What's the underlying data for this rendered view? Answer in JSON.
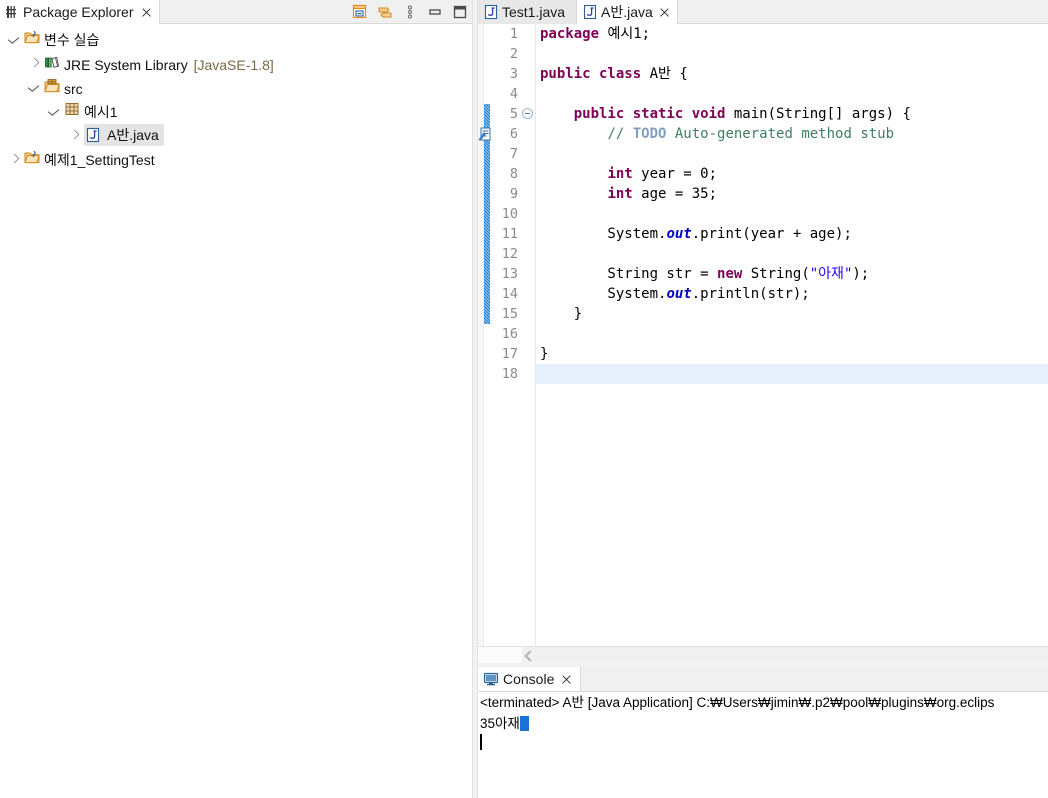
{
  "explorer": {
    "tab": {
      "label": "Package Explorer",
      "icon": "package-explorer-icon",
      "close": "close-icon"
    },
    "toolbar": [
      {
        "name": "collapse-all-icon",
        "title": "Collapse All"
      },
      {
        "name": "link-with-editor-icon",
        "title": "Link with Editor"
      },
      {
        "name": "view-menu-icon",
        "title": "View Menu"
      },
      {
        "name": "minimize-icon",
        "title": "Minimize"
      },
      {
        "name": "maximize-icon",
        "title": "Maximize"
      }
    ],
    "tree": [
      {
        "indent": 0,
        "twist": "open",
        "icon": "java-project-icon",
        "label": "변수 실습",
        "suffix": "",
        "selected": false
      },
      {
        "indent": 1,
        "twist": "closed",
        "icon": "jre-library-icon",
        "label": "JRE System Library ",
        "suffix": "[JavaSE-1.8]",
        "selected": false
      },
      {
        "indent": 1,
        "twist": "open",
        "icon": "source-folder-icon",
        "label": "src",
        "suffix": "",
        "selected": false
      },
      {
        "indent": 2,
        "twist": "open",
        "icon": "package-icon",
        "label": "예시1",
        "suffix": "",
        "selected": false
      },
      {
        "indent": 3,
        "twist": "closed",
        "icon": "java-file-icon",
        "label": "A반.java",
        "suffix": "",
        "selected": true
      },
      {
        "indent": 0,
        "twist": "closed",
        "icon": "java-project-icon",
        "label": "예제1_SettingTest",
        "suffix": "",
        "selected": false
      }
    ]
  },
  "editor": {
    "tabs": [
      {
        "label": "Test1.java",
        "icon": "java-file-icon",
        "active": false,
        "closable": false
      },
      {
        "label": "A반.java",
        "icon": "java-file-icon",
        "active": true,
        "closable": true
      }
    ],
    "hscroll_arrow": "scroll-left-arrow-icon",
    "current_line": 18,
    "change_bar_from": 5,
    "change_bar_to": 15,
    "fold_line": 5,
    "todo_marker_line": 6,
    "line_numbers": [
      1,
      2,
      3,
      4,
      5,
      6,
      7,
      8,
      9,
      10,
      11,
      12,
      13,
      14,
      15,
      16,
      17,
      18
    ],
    "lines": [
      {
        "n": 1,
        "tokens": [
          {
            "t": "kw",
            "v": "package"
          },
          {
            "t": "pln",
            "v": " 예시1;"
          }
        ]
      },
      {
        "n": 2,
        "tokens": []
      },
      {
        "n": 3,
        "tokens": [
          {
            "t": "kw",
            "v": "public class"
          },
          {
            "t": "pln",
            "v": " A반 {"
          }
        ]
      },
      {
        "n": 4,
        "tokens": []
      },
      {
        "n": 5,
        "tokens": [
          {
            "t": "pln",
            "v": "    "
          },
          {
            "t": "kw",
            "v": "public static void"
          },
          {
            "t": "pln",
            "v": " main(String[] args) {"
          }
        ]
      },
      {
        "n": 6,
        "tokens": [
          {
            "t": "pln",
            "v": "        "
          },
          {
            "t": "cmt",
            "v": "// "
          },
          {
            "t": "todo",
            "v": "TODO"
          },
          {
            "t": "cmt",
            "v": " Auto-generated method stub"
          }
        ]
      },
      {
        "n": 7,
        "tokens": []
      },
      {
        "n": 8,
        "tokens": [
          {
            "t": "pln",
            "v": "        "
          },
          {
            "t": "kw",
            "v": "int"
          },
          {
            "t": "pln",
            "v": " year = 0;"
          }
        ]
      },
      {
        "n": 9,
        "tokens": [
          {
            "t": "pln",
            "v": "        "
          },
          {
            "t": "kw",
            "v": "int"
          },
          {
            "t": "pln",
            "v": " age = 35;"
          }
        ]
      },
      {
        "n": 10,
        "tokens": []
      },
      {
        "n": 11,
        "tokens": [
          {
            "t": "pln",
            "v": "        System."
          },
          {
            "t": "fld",
            "v": "out"
          },
          {
            "t": "pln",
            "v": ".print(year + age);"
          }
        ]
      },
      {
        "n": 12,
        "tokens": []
      },
      {
        "n": 13,
        "tokens": [
          {
            "t": "pln",
            "v": "        String str = "
          },
          {
            "t": "kw",
            "v": "new"
          },
          {
            "t": "pln",
            "v": " String("
          },
          {
            "t": "str",
            "v": "\"아재\""
          },
          {
            "t": "pln",
            "v": ");"
          }
        ]
      },
      {
        "n": 14,
        "tokens": [
          {
            "t": "pln",
            "v": "        System."
          },
          {
            "t": "fld",
            "v": "out"
          },
          {
            "t": "pln",
            "v": ".println(str);"
          }
        ]
      },
      {
        "n": 15,
        "tokens": [
          {
            "t": "pln",
            "v": "    }"
          }
        ]
      },
      {
        "n": 16,
        "tokens": []
      },
      {
        "n": 17,
        "tokens": [
          {
            "t": "pln",
            "v": "}"
          }
        ]
      },
      {
        "n": 18,
        "tokens": []
      }
    ]
  },
  "console": {
    "tab": {
      "label": "Console",
      "icon": "console-icon",
      "close": "close-icon"
    },
    "terminated_line": "<terminated> A반 [Java Application] C:₩Users₩jimin₩.p2₩pool₩plugins₩org.eclips",
    "output": "35아재",
    "has_selection_block": true,
    "has_caret": true
  },
  "colors": {
    "keyword": "#7f0055",
    "string": "#2a00ff",
    "comment": "#3f7f5f",
    "todo": "#7f9fbf",
    "field": "#0000c0",
    "current_line_bg": "#e6effc",
    "change_bar": "#1c7fd4",
    "selection": "#1a73d4",
    "tree_selection_bg": "#e4e4e4",
    "tab_inactive_bg": "#e8e8e8",
    "panel_bg": "#f0f0f0"
  }
}
